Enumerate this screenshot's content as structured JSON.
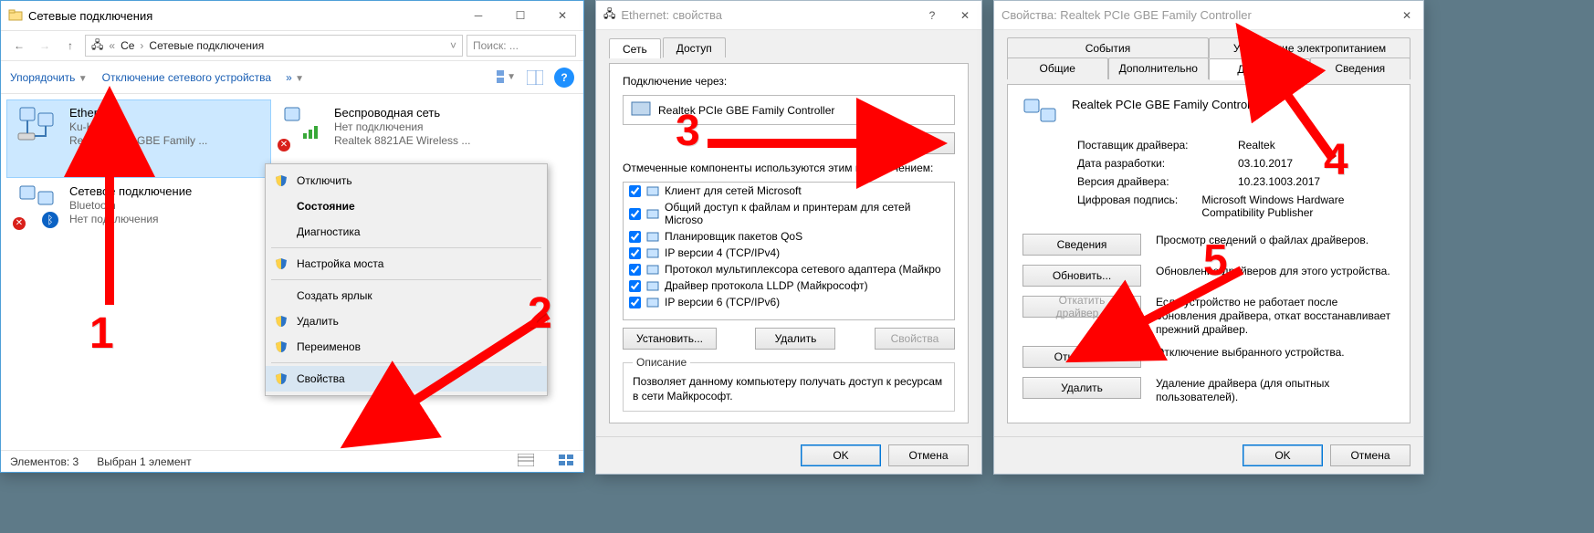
{
  "win1": {
    "title": "Сетевые подключения",
    "breadcrumb_root": "Се",
    "breadcrumb_leaf": "Сетевые подключения",
    "search_placeholder": "Поиск: ...",
    "organize": "Упорядочить",
    "disable": "Отключение сетевого устройства",
    "overflow": "»",
    "connections": [
      {
        "name": "Ethernet",
        "status": "Ku-Ku",
        "device": "Realtek PCIe GBE Family ..."
      },
      {
        "name": "Беспроводная сеть",
        "status": "Нет подключения",
        "device": "Realtek 8821AE Wireless ..."
      },
      {
        "name": "Сетевое подключение",
        "status": "Bluetooth",
        "device": "Нет подключения"
      }
    ],
    "context_menu": [
      {
        "label": "Отключить",
        "shield": true
      },
      {
        "label": "Состояние",
        "bold": true
      },
      {
        "label": "Диагностика"
      },
      {
        "sep": true
      },
      {
        "label": "Настройка моста",
        "shield": true
      },
      {
        "sep": true
      },
      {
        "label": "Создать ярлык"
      },
      {
        "label": "Удалить",
        "shield": true
      },
      {
        "label": "Переименов",
        "shield": true
      },
      {
        "sep": true
      },
      {
        "label": "Свойства",
        "shield": true,
        "hover": true
      }
    ],
    "status_items": "Элементов: 3",
    "status_sel": "Выбран 1 элемент"
  },
  "win2": {
    "title": "Ethernet: свойства",
    "tabs": [
      "Сеть",
      "Доступ"
    ],
    "connect_via": "Подключение через:",
    "device": "Realtek PCIe GBE Family Controller",
    "configure": "Настроить...",
    "components_label": "Отмеченные компоненты используются этим подключением:",
    "components": [
      "Клиент для сетей Microsoft",
      "Общий доступ к файлам и принтерам для сетей Microso",
      "Планировщик пакетов QoS",
      "IP версии 4 (TCP/IPv4)",
      "Протокол мультиплексора сетевого адаптера (Майкро",
      "Драйвер протокола LLDP (Майкрософт)",
      "IP версии 6 (TCP/IPv6)"
    ],
    "install": "Установить...",
    "remove": "Удалить",
    "properties": "Свойства",
    "desc_title": "Описание",
    "desc_text": "Позволяет данному компьютеру получать доступ к ресурсам в сети Майкрософт.",
    "ok": "OK",
    "cancel": "Отмена"
  },
  "win3": {
    "title": "Свойства: Realtek PCIe GBE Family Controller",
    "tabs_top": [
      "События",
      "Управление электропитанием"
    ],
    "tabs_bot": [
      "Общие",
      "Дополнительно",
      "Драйвер",
      "Сведения"
    ],
    "device": "Realtek PCIe GBE Family Controller",
    "rows": [
      {
        "k": "Поставщик драйвера:",
        "v": "Realtek"
      },
      {
        "k": "Дата разработки:",
        "v": "03.10.2017"
      },
      {
        "k": "Версия драйвера:",
        "v": "10.23.1003.2017"
      },
      {
        "k": "Цифровая подпись:",
        "v": "Microsoft Windows Hardware Compatibility Publisher"
      }
    ],
    "buttons": [
      {
        "label": "Сведения",
        "hint": "Просмотр сведений о файлах драйверов."
      },
      {
        "label": "Обновить...",
        "hint": "Обновление драйверов для этого устройства."
      },
      {
        "label": "Откатить драйвер...",
        "hint": "Если устройство не работает после обновления драйвера, откат восстанавливает прежний драйвер.",
        "disabled": true
      },
      {
        "label": "Отключить",
        "hint": "Отключение выбранного устройства."
      },
      {
        "label": "Удалить",
        "hint": "Удаление драйвера (для опытных пользователей)."
      }
    ],
    "ok": "OK",
    "cancel": "Отмена"
  },
  "anno": [
    "1",
    "2",
    "3",
    "4",
    "5"
  ]
}
